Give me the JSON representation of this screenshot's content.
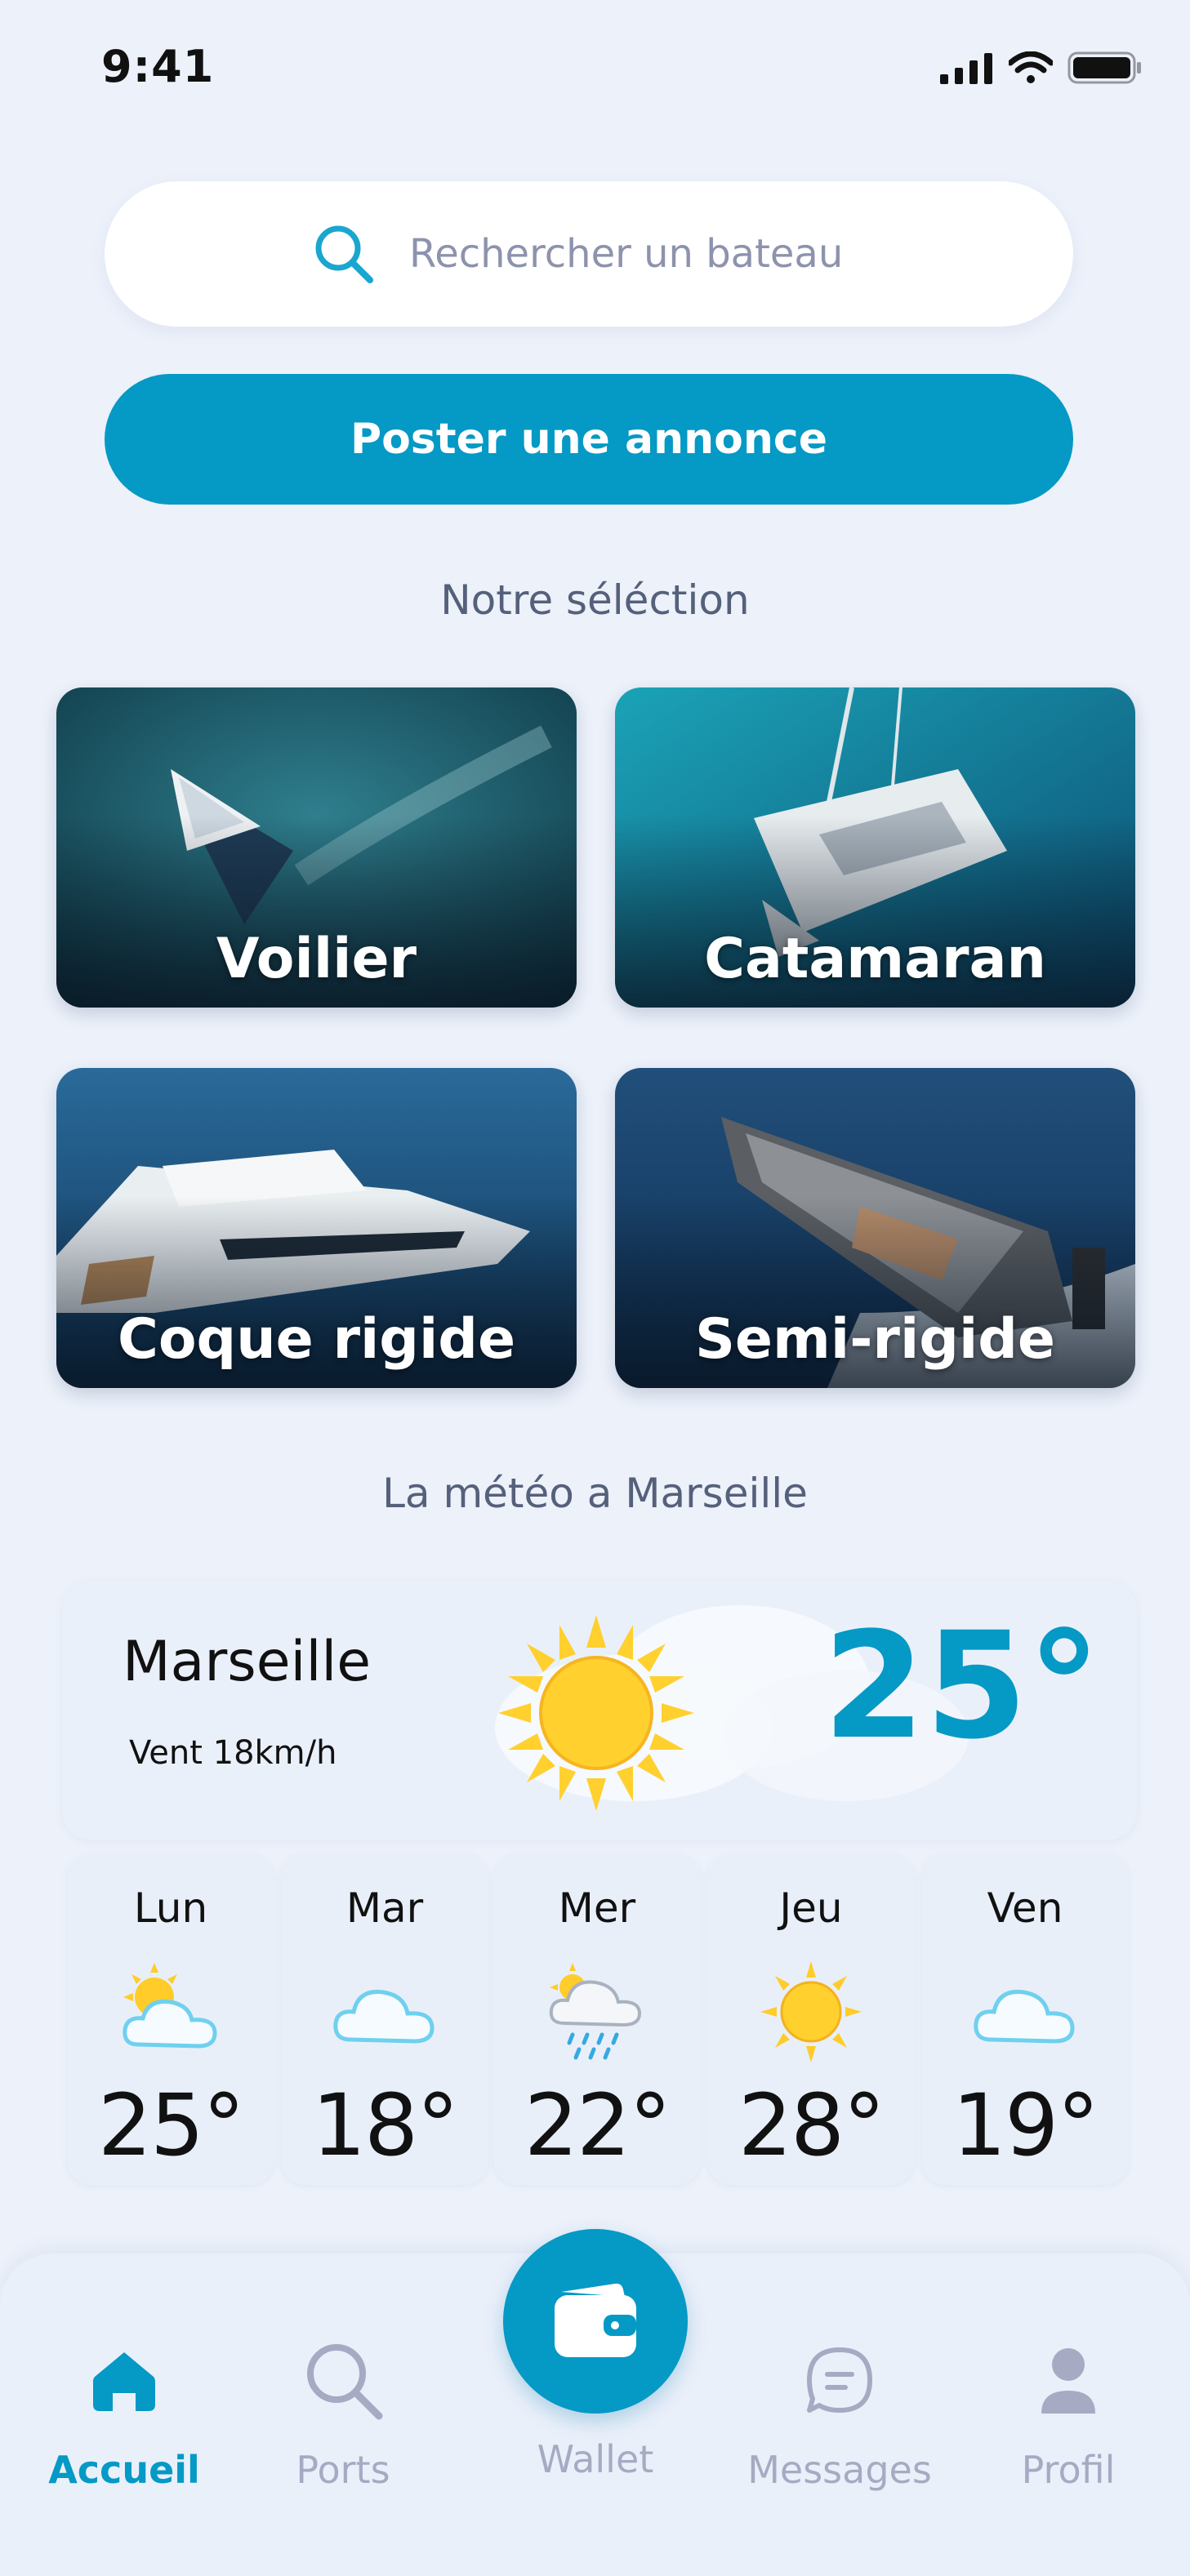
{
  "status_bar": {
    "time": "9:41"
  },
  "search": {
    "placeholder": "Rechercher un bateau"
  },
  "post_button": {
    "label": "Poster une annonce"
  },
  "selection": {
    "title": "Notre séléction",
    "categories": [
      {
        "label": "Voilier"
      },
      {
        "label": "Catamaran"
      },
      {
        "label": "Coque rigide"
      },
      {
        "label": "Semi-rigide"
      }
    ]
  },
  "weather": {
    "title": "La météo a Marseille",
    "city": "Marseille",
    "wind": "Vent 18km/h",
    "temperature": "25°",
    "current_icon": "sun-icon",
    "forecast": [
      {
        "day": "Lun",
        "temp": "25°",
        "icon": "partly-cloudy-icon"
      },
      {
        "day": "Mar",
        "temp": "18°",
        "icon": "cloud-icon"
      },
      {
        "day": "Mer",
        "temp": "22°",
        "icon": "rain-icon"
      },
      {
        "day": "Jeu",
        "temp": "28°",
        "icon": "sun-icon"
      },
      {
        "day": "Ven",
        "temp": "19°",
        "icon": "cloud-icon"
      }
    ]
  },
  "nav": {
    "items": [
      {
        "label": "Accueil",
        "icon": "home-icon",
        "active": true
      },
      {
        "label": "Ports",
        "icon": "search-icon",
        "active": false
      },
      {
        "label": "Wallet",
        "icon": "wallet-icon",
        "active": false
      },
      {
        "label": "Messages",
        "icon": "message-icon",
        "active": false
      },
      {
        "label": "Profil",
        "icon": "profile-icon",
        "active": false
      }
    ]
  },
  "colors": {
    "accent": "#0599c5",
    "background": "#ecf1fa",
    "muted_text": "#8d93ad",
    "inactive_nav": "#a6abc3",
    "sun": "#ffd02e"
  }
}
